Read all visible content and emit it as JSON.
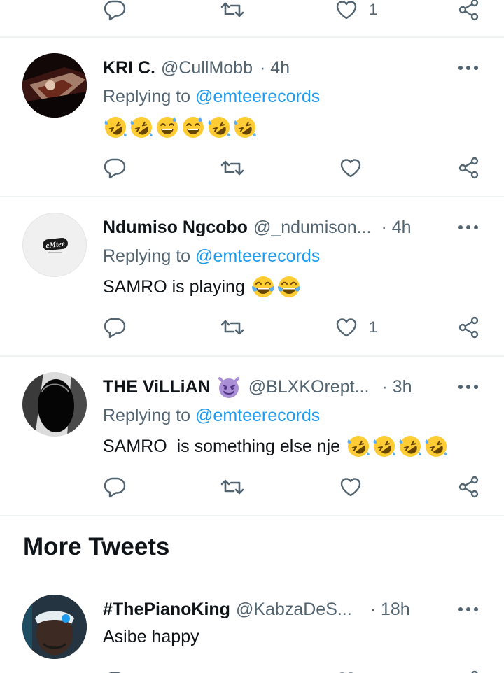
{
  "top_actions": {
    "like_count": "1"
  },
  "tweets": [
    {
      "name": "KRI C.",
      "handle": "@CullMobb",
      "time": "· 4h",
      "replying_prefix": "Replying to ",
      "mention": "@emteerecords",
      "text": "",
      "emojis": [
        "rofl",
        "rofl",
        "sweat-smile",
        "sweat-smile",
        "rofl",
        "rofl"
      ],
      "like_count": ""
    },
    {
      "name": "Ndumiso Ngcobo",
      "handle": "@_ndumison...",
      "time": "· 4h",
      "replying_prefix": "Replying to ",
      "mention": "@emteerecords",
      "text": "SAMRO is playing",
      "emojis": [
        "joy",
        "joy"
      ],
      "like_count": "1",
      "avatar_logo": "eMtee"
    },
    {
      "name": "THE ViLLiAN",
      "name_emoji": "smiling-imp",
      "handle": "@BLXKOrept...",
      "time": "· 3h",
      "replying_prefix": "Replying to ",
      "mention": "@emteerecords",
      "text": "SAMRO  is something else nje",
      "emojis": [
        "rofl",
        "rofl",
        "rofl",
        "rofl"
      ],
      "like_count": ""
    }
  ],
  "more_tweets": {
    "title": "More Tweets",
    "tweet": {
      "name": "#ThePianoKing",
      "handle": "@KabzaDeS...",
      "time": "· 18h",
      "text": "Asibe happy"
    }
  },
  "icons": {
    "reply": "speech-bubble-icon",
    "retweet": "retweet-icon",
    "like": "heart-icon",
    "share": "share-icon",
    "more": "more-dots-icon"
  },
  "colors": {
    "link": "#1d9bf0",
    "muted": "#536471",
    "text": "#0f1419",
    "divider": "#eff3f4"
  }
}
